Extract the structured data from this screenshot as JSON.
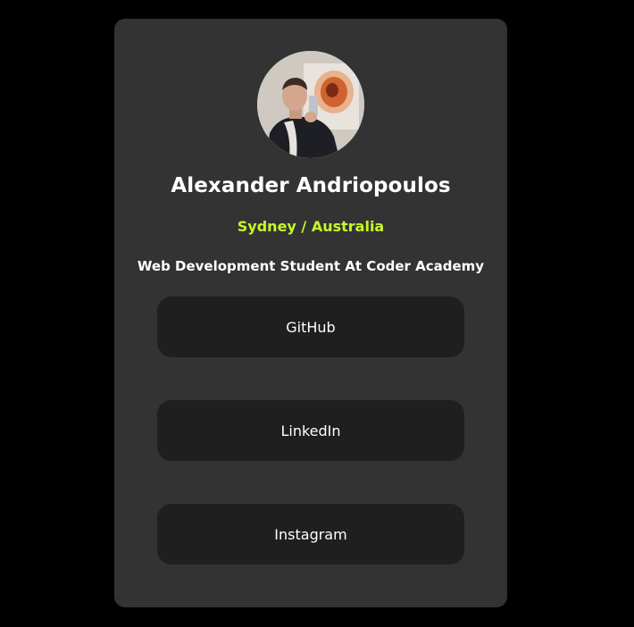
{
  "profile": {
    "name": "Alexander Andriopoulos",
    "location": "Sydney / Australia",
    "bio": "Web Development Student At Coder Academy"
  },
  "links": [
    {
      "label": "GitHub"
    },
    {
      "label": "LinkedIn"
    },
    {
      "label": "Instagram"
    }
  ],
  "colors": {
    "background": "#000000",
    "card": "#333333",
    "button": "#1f1f1f",
    "accent": "#c5f82a",
    "text": "#ffffff"
  }
}
